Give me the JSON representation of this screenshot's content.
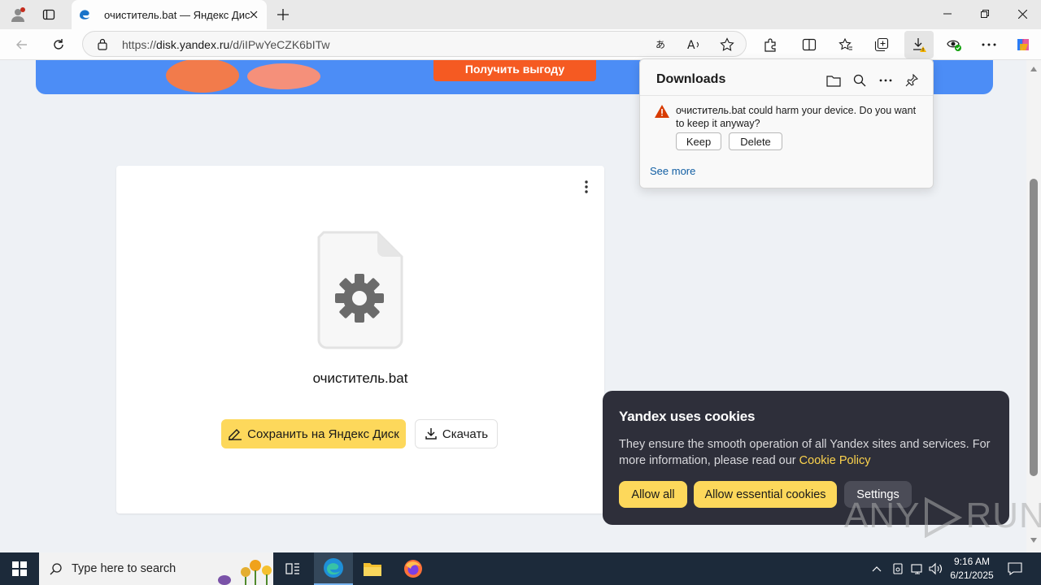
{
  "browser": {
    "tab": {
      "title": "очиститель.bat — Яндекс Диск"
    },
    "address": {
      "prefix": "https://",
      "host": "disk.yandex.ru",
      "path": "/d/iIPwYeCZK6bITw"
    }
  },
  "banner": {
    "button_label": "Получить выгоду"
  },
  "file_card": {
    "filename": "очиститель.bat",
    "save_label": "Сохранить на Яндекс Диск",
    "download_label": "Скачать"
  },
  "downloads": {
    "title": "Downloads",
    "warning": "очиститель.bat could harm your device. Do you want to keep it anyway?",
    "keep_label": "Keep",
    "delete_label": "Delete",
    "see_more": "See more"
  },
  "cookies": {
    "title": "Yandex uses cookies",
    "text": "They ensure the smooth operation of all Yandex sites and services. For more information, please read our ",
    "link": "Cookie Policy",
    "allow_all": "Allow all",
    "allow_essential": "Allow essential cookies",
    "settings": "Settings"
  },
  "watermark": {
    "left": "ANY",
    "right": "RUN"
  },
  "taskbar": {
    "search_placeholder": "Type here to search",
    "time": "9:16 AM",
    "date": "6/21/2025"
  },
  "colors": {
    "yandex_yellow": "#fdd85b",
    "banner_blue": "#4c8df6",
    "banner_button": "#f55a22",
    "cookie_bg": "#2e2f3a",
    "warning": "#d83b01"
  },
  "icons": [
    "profile-icon",
    "tab-actions-icon",
    "edge-icon",
    "close-icon",
    "plus-icon",
    "minimize-icon",
    "restore-icon",
    "back-icon",
    "refresh-icon",
    "lock-icon",
    "translate-icon",
    "read-aloud-icon",
    "star-icon",
    "extensions-icon",
    "split-screen-icon",
    "favorites-icon",
    "collections-icon",
    "download-icon",
    "performance-icon",
    "more-icon",
    "copilot-icon",
    "folder-icon",
    "search-icon",
    "pin-icon",
    "warning-icon",
    "gear-icon",
    "pencil-icon",
    "windows-icon",
    "task-view-icon",
    "file-explorer-icon",
    "firefox-icon",
    "network-icon",
    "volume-icon",
    "notification-icon"
  ]
}
